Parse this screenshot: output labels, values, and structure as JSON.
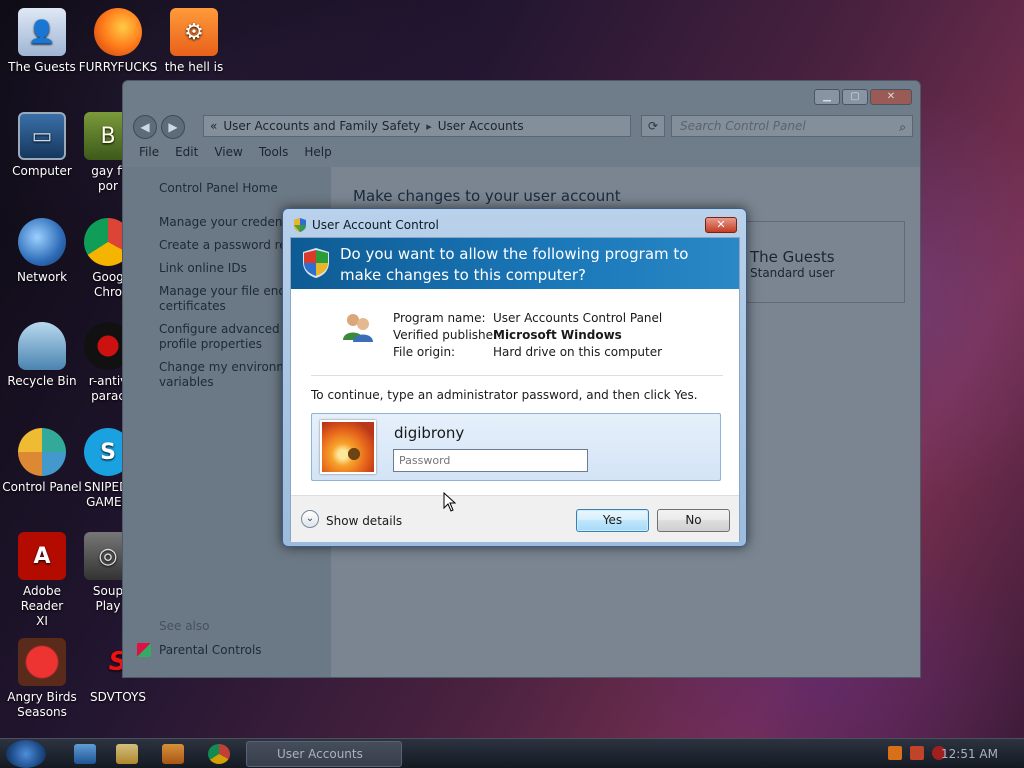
{
  "desktop": {
    "icons": [
      {
        "label": "The Guests"
      },
      {
        "label": "FURRYFUCKS"
      },
      {
        "label": "the hell is"
      },
      {
        "label": "Computer"
      },
      {
        "label": "gay fi\npor"
      },
      {
        "label": "Network"
      },
      {
        "label": "Goog\nChro"
      },
      {
        "label": "Recycle Bin"
      },
      {
        "label": "r-antiv\nparac"
      },
      {
        "label": "Control Panel"
      },
      {
        "label": "SNIPEDI\nGAMER"
      },
      {
        "label": "Adobe Reader\nXI"
      },
      {
        "label": "Soup\nPlay"
      },
      {
        "label": "Angry Birds\nSeasons"
      },
      {
        "label": "SDVTOYS"
      }
    ]
  },
  "explorer": {
    "address": {
      "prefix": "«",
      "crumb1": "User Accounts and Family Safety",
      "crumb2": "User Accounts"
    },
    "search_placeholder": "Search Control Panel",
    "menu": [
      "File",
      "Edit",
      "View",
      "Tools",
      "Help"
    ],
    "left_pane": {
      "home": "Control Panel Home",
      "links": [
        "Manage your credentia",
        "Create a password rese",
        "Link online IDs",
        "Manage your file encry\ncertificates",
        "Configure advanced us\nprofile properties",
        "Change my environme\nvariables"
      ],
      "see_also": "See also",
      "parental": "Parental Controls"
    },
    "main": {
      "heading": "Make changes to your user account",
      "user_name": "The Guests",
      "user_type": "Standard user"
    }
  },
  "uac": {
    "title": "User Account Control",
    "close": "✕",
    "question": "Do you want to allow the following program to make changes to this computer?",
    "program": {
      "name_label": "Program name:",
      "name_value": "User Accounts Control Panel",
      "publisher_label": "Verified publisher:",
      "publisher_value": "Microsoft Windows",
      "origin_label": "File origin:",
      "origin_value": "Hard drive on this computer"
    },
    "instruction": "To continue, type an administrator password, and then click Yes.",
    "username": "digibrony",
    "password_placeholder": "Password",
    "password_value": "",
    "show_details": "Show details",
    "yes": "Yes",
    "no": "No"
  },
  "taskbar": {
    "active_task": "User Accounts",
    "clock": "12:51 AM"
  },
  "colors": {
    "banner": "#1b78b9",
    "yes_border": "#3c7fb1"
  }
}
